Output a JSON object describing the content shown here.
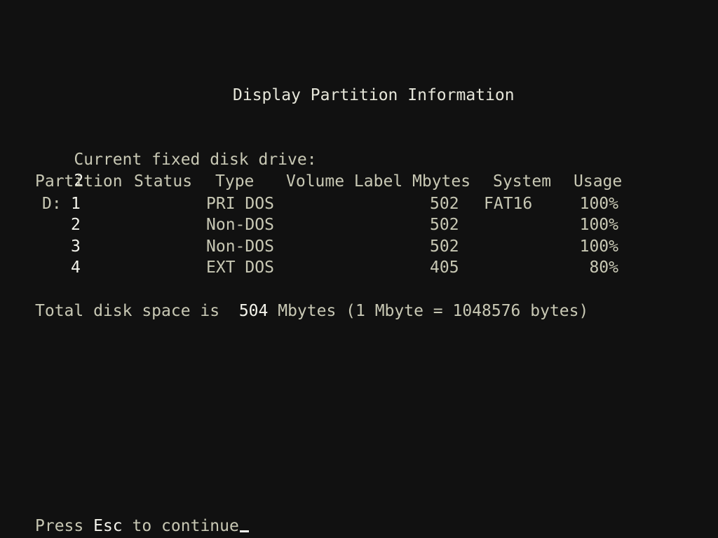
{
  "title": "Display Partition Information",
  "drive": {
    "label": "Current fixed disk drive:",
    "value": "2"
  },
  "columns": {
    "partition": "Partition",
    "status": "Status",
    "type": "Type",
    "volume_label": "Volume Label",
    "mbytes": "Mbytes",
    "system": "System",
    "usage": "Usage"
  },
  "partitions": [
    {
      "drive_letter": "D:",
      "number": "1",
      "status": "",
      "type": "PRI DOS",
      "volume_label": "",
      "mbytes": "502",
      "system": "FAT16",
      "usage": "100%"
    },
    {
      "drive_letter": "",
      "number": "2",
      "status": "",
      "type": "Non-DOS",
      "volume_label": "",
      "mbytes": "502",
      "system": "",
      "usage": "100%"
    },
    {
      "drive_letter": "",
      "number": "3",
      "status": "",
      "type": "Non-DOS",
      "volume_label": "",
      "mbytes": "502",
      "system": "",
      "usage": "100%"
    },
    {
      "drive_letter": "",
      "number": "4",
      "status": "",
      "type": "EXT DOS",
      "volume_label": "",
      "mbytes": "405",
      "system": "",
      "usage": "80%"
    }
  ],
  "total": {
    "prefix": "Total disk space is",
    "value": "504",
    "suffix": "Mbytes (1 Mbyte = 1048576 bytes)"
  },
  "footer": {
    "press": "Press",
    "key": "Esc",
    "rest": "to continue"
  },
  "colors": {
    "background": "#111111",
    "text": "#c8c8b4",
    "highlight": "#f4f4ec"
  }
}
